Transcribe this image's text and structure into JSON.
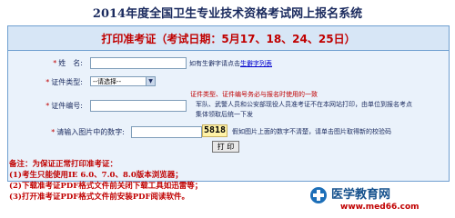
{
  "page_title": "2014年度全国卫生专业技术资格考试网上报名系统",
  "panel": {
    "heading": "打印准考证（考试日期：5月17、18、24、25日）"
  },
  "form": {
    "name_label": "姓　名:",
    "name_hint_prefix": "如有生僻字请点击",
    "name_hint_link": "生僻字列表",
    "id_type_label": "证件类型:",
    "id_type_value": "--请选择--",
    "id_number_label": "证件编号:",
    "id_note_1": "证件类型、证件编号务必与报名时使用的一致",
    "id_note_2": "军队、武警人员和公安部现役人员准考证不在本网站打印，由单位到报名考点",
    "id_note_3": "集体领取后统一下发",
    "captcha_label": "请输入图片中的数字:",
    "captcha_value": "5818",
    "captcha_hint": "假如图片上面的数字不清楚，请单击图片取得新的校验码",
    "print_button": "打 印"
  },
  "notes": [
    "备注：为保证正常打印准考证：",
    "(1)考生只能使用IE 6.0、7.0、8.0版本浏览器；",
    "(2)下载准考证PDF格式文件前关闭下载工具如迅雷等；",
    "(3)打开准考证PDF格式文件前安装PDF阅读软件。"
  ],
  "logo": {
    "name": "医学教育网",
    "url": "www.med66.com"
  }
}
